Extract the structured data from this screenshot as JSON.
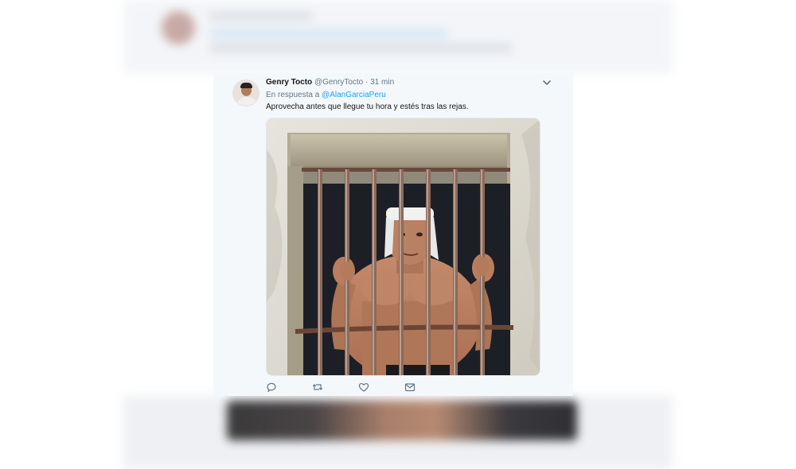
{
  "tweet": {
    "display_name": "Genry Tocto",
    "username": "@GenryTocto",
    "separator": "·",
    "time": "31 min",
    "reply_prefix": "En respuesta a",
    "reply_mention": "@AlanGarciaPeru",
    "text": "Aprovecha antes que llegue tu hora y estés tras las rejas."
  },
  "icons": {
    "more": "chevron-down-icon",
    "reply": "reply-icon",
    "retweet": "retweet-icon",
    "like": "heart-icon",
    "dm": "mail-icon"
  },
  "colors": {
    "link": "#1da1f2",
    "secondary_text": "#657786",
    "primary_text": "#14171a",
    "card_background": "#f5f8fa"
  }
}
